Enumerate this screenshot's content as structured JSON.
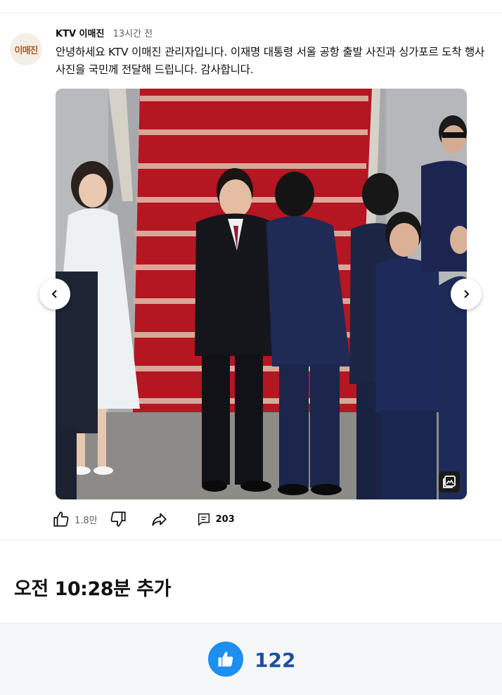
{
  "post": {
    "avatar_text": "이매진",
    "channel": "KTV 이매진",
    "time": "13시간 전",
    "text": "안녕하세요 KTV 이매진 관리자입니다. 이재명 대통령 서울 공항 출발 사진과 싱가포르 도착 행사 사진을 국민께 전달해 드립니다. 감사합니다.",
    "image_icon": "gallery-icon",
    "actions": {
      "like_count": "1.8만",
      "comment_count": "203",
      "like_icon": "thumbs-up-icon",
      "dislike_icon": "thumbs-down-icon",
      "share_icon": "share-icon",
      "comment_icon": "comment-icon"
    }
  },
  "added_note": "오전 10:28분 추가",
  "footer": {
    "like_icon": "thumbs-up-icon",
    "like_count": "122",
    "accent": "#1d8ff0"
  }
}
